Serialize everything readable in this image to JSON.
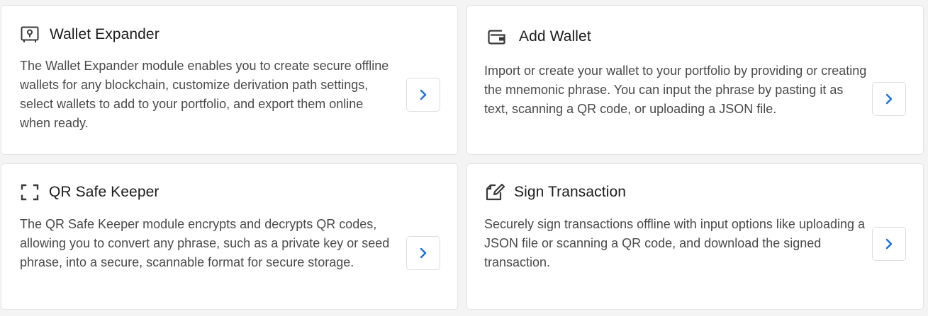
{
  "accent_color": "#1a6fdc",
  "icon_color": "#3a3a3a",
  "cards": [
    {
      "icon": "safe-icon",
      "title": "Wallet Expander",
      "description": "The Wallet Expander module enables you to create secure offline wallets for any blockchain, customize derivation path settings, select wallets to add to your portfolio, and export them online when ready.",
      "action_icon": "chevron-right-icon"
    },
    {
      "icon": "wallet-icon",
      "title": "Add Wallet",
      "description": "Import or create your wallet to your portfolio by providing or creating the mnemonic phrase. You can input the phrase by pasting it as text, scanning a QR code, or uploading a JSON file.",
      "action_icon": "chevron-right-icon"
    },
    {
      "icon": "scan-frame-icon",
      "title": "QR Safe Keeper",
      "description": "The QR Safe Keeper module encrypts and decrypts QR codes, allowing you to convert any phrase, such as a private key or seed phrase, into a secure, scannable format for secure storage.",
      "action_icon": "chevron-right-icon"
    },
    {
      "icon": "sign-edit-icon",
      "title": "Sign Transaction",
      "description": "Securely sign transactions offline with input options like uploading a JSON file or scanning a QR code, and download the signed transaction.",
      "action_icon": "chevron-right-icon"
    }
  ]
}
